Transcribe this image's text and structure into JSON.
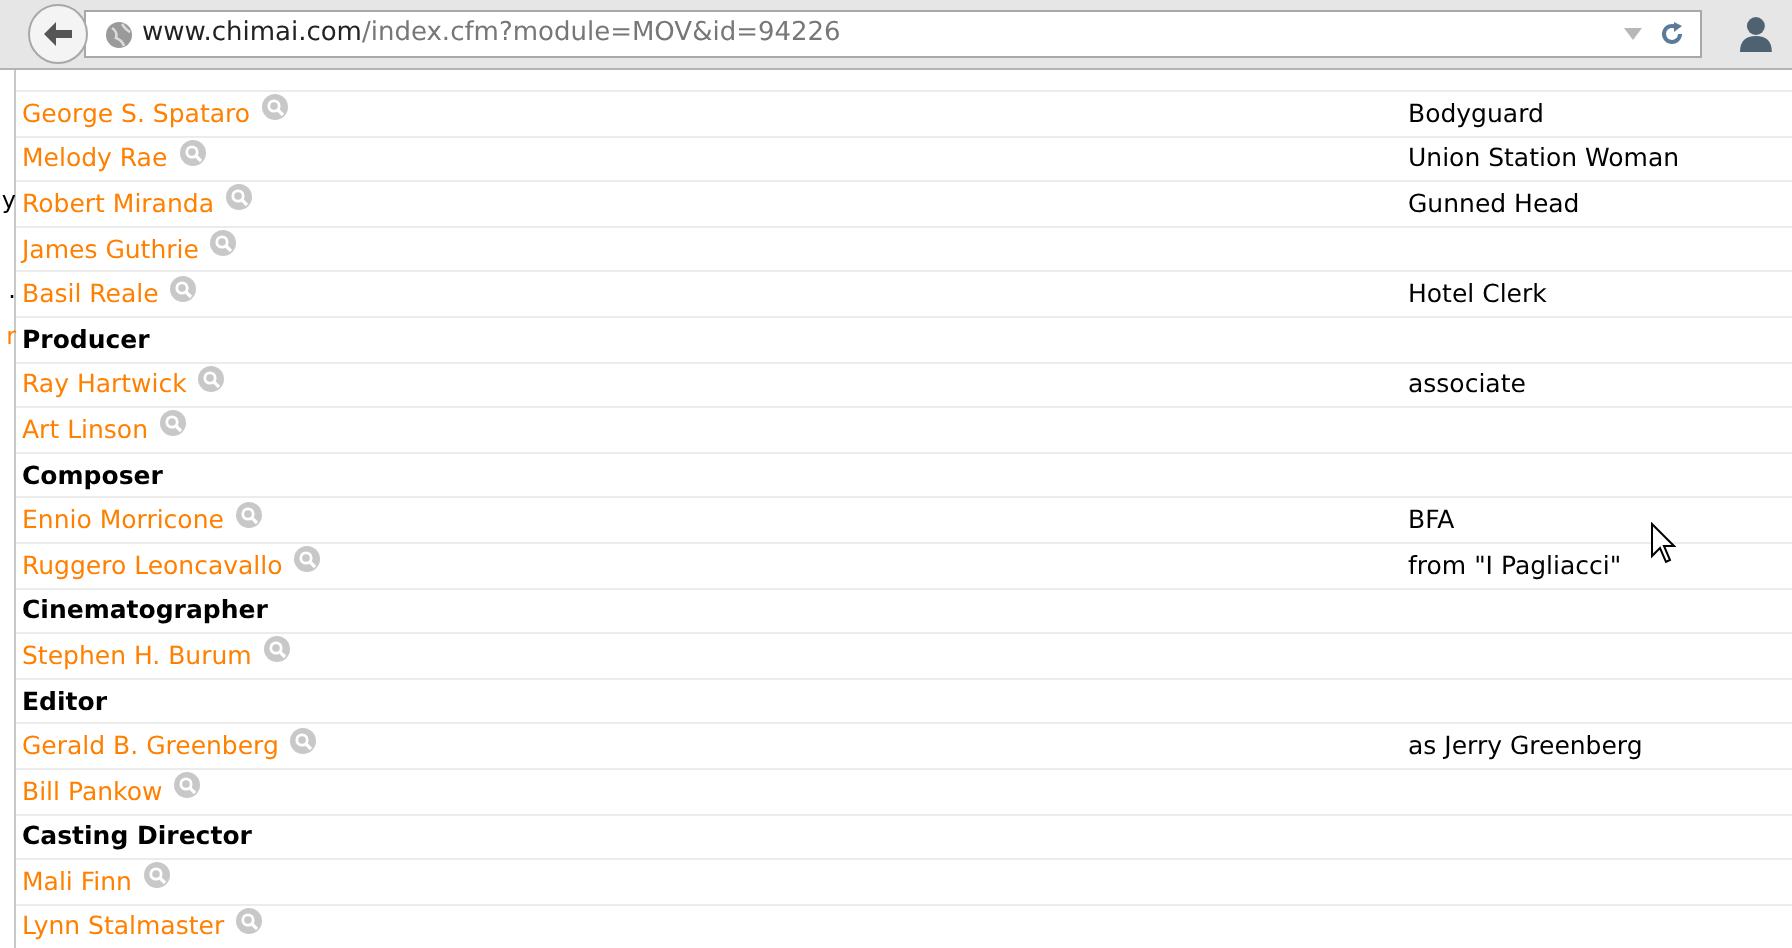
{
  "browser": {
    "url_host": "www.chimai.com",
    "url_path": "/index.cfm?module=MOV&id=94226"
  },
  "rows": [
    {
      "kind": "person",
      "name": "George S. Spataro",
      "role": "Bodyguard"
    },
    {
      "kind": "person",
      "name": "Melody Rae",
      "role": "Union Station Woman"
    },
    {
      "kind": "person",
      "name": "Robert Miranda",
      "role": "Gunned Head",
      "left_fragment": {
        "text": "y",
        "kind": "plain"
      }
    },
    {
      "kind": "person",
      "name": "James Guthrie"
    },
    {
      "kind": "person",
      "name": "Basil Reale",
      "role": "Hotel Clerk",
      "left_fragment": {
        "text": ".",
        "kind": "plain"
      }
    },
    {
      "kind": "heading",
      "name": "Producer",
      "left_fragment": {
        "text": "r",
        "kind": "link"
      }
    },
    {
      "kind": "person",
      "name": "Ray Hartwick",
      "role": "associate"
    },
    {
      "kind": "person",
      "name": "Art Linson"
    },
    {
      "kind": "heading",
      "name": "Composer"
    },
    {
      "kind": "person",
      "name": "Ennio Morricone",
      "role": "BFA"
    },
    {
      "kind": "person",
      "name": "Ruggero Leoncavallo",
      "role": "from \"I Pagliacci\""
    },
    {
      "kind": "heading",
      "name": "Cinematographer"
    },
    {
      "kind": "person",
      "name": "Stephen H. Burum"
    },
    {
      "kind": "heading",
      "name": "Editor"
    },
    {
      "kind": "person",
      "name": "Gerald B. Greenberg",
      "role": "as Jerry Greenberg"
    },
    {
      "kind": "person",
      "name": "Bill Pankow"
    },
    {
      "kind": "heading",
      "name": "Casting Director"
    },
    {
      "kind": "person",
      "name": "Mali Finn"
    },
    {
      "kind": "person",
      "name": "Lynn Stalmaster"
    }
  ]
}
